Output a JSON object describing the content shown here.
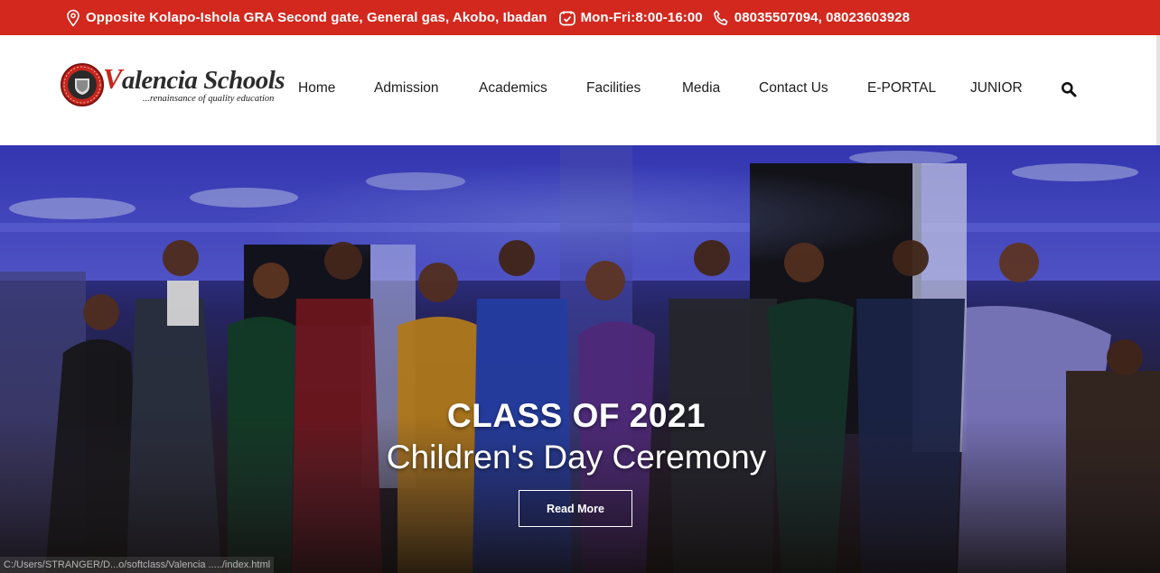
{
  "topbar": {
    "address": "Opposite Kolapo-Ishola GRA Second gate, General gas, Akobo, Ibadan",
    "hours": "Mon-Fri:8:00-16:00",
    "phones": "08035507094, 08023603928",
    "icons": [
      "location-pin-icon",
      "clock-icon",
      "phone-icon"
    ]
  },
  "header": {
    "logo": {
      "name_initial": "V",
      "name_rest": "alencia Schools",
      "tagline": "...renainsance of quality education"
    },
    "nav": [
      {
        "label": "Home"
      },
      {
        "label": "Admission"
      },
      {
        "label": "Academics"
      },
      {
        "label": "Facilities"
      },
      {
        "label": "Media"
      },
      {
        "label": "Contact Us"
      },
      {
        "label": "E-PORTAL"
      },
      {
        "label": "JUNIOR"
      }
    ],
    "search_icon": "search-icon"
  },
  "hero": {
    "title": "CLASS OF 2021",
    "subtitle": "Children's Day Ceremony",
    "button_label": "Read More",
    "status_url": "C:/Users/STRANGER/D...o/softclass/Valencia ...../index.html"
  },
  "colors": {
    "topbar_bg": "#d2281e",
    "brand_red": "#c8261d",
    "text_dark": "#1d1d1d"
  }
}
